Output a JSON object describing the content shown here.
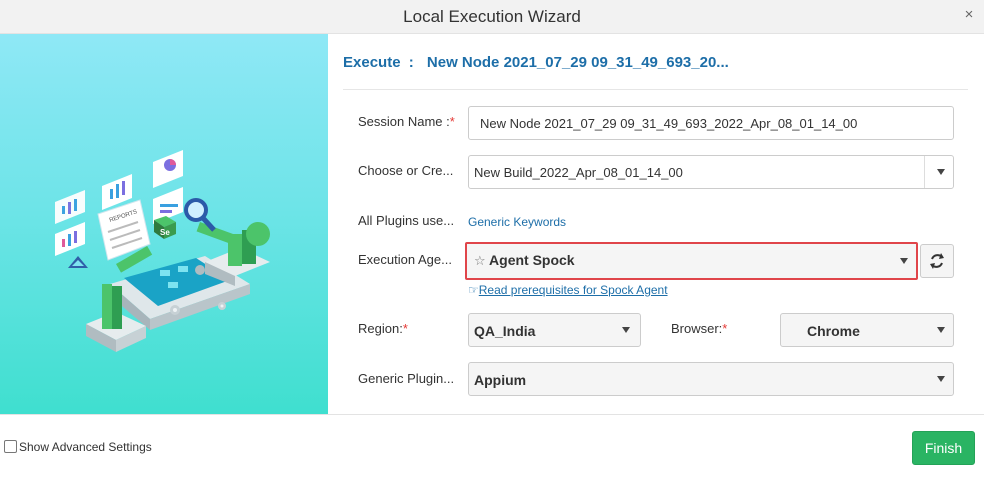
{
  "dialog": {
    "title": "Local Execution Wizard",
    "close_glyph": "×"
  },
  "execute": {
    "label": "Execute",
    "separator": ":",
    "node_name": "New Node 2021_07_29 09_31_49_693_20..."
  },
  "form": {
    "session_name": {
      "label": "Session Name :",
      "required_mark": "*",
      "value": "New Node 2021_07_29 09_31_49_693_2022_Apr_08_01_14_00"
    },
    "build": {
      "label": "Choose or Cre...",
      "value": "New Build_2022_Apr_08_01_14_00"
    },
    "plugins": {
      "label": "All Plugins use...",
      "link": "Generic Keywords"
    },
    "execution_agent": {
      "label": "Execution Age...",
      "star": "☆",
      "value": "Agent Spock",
      "prereq_icon": "☞",
      "prereq_link": "Read prerequisites for Spock Agent"
    },
    "region": {
      "label": "Region:",
      "required_mark": "*",
      "value": "QA_India"
    },
    "browser": {
      "label": "Browser:",
      "required_mark": "*",
      "value": "Chrome"
    },
    "generic_plugin": {
      "label": "Generic Plugin...",
      "value": "Appium"
    }
  },
  "footer": {
    "show_advanced_label": "Show Advanced Settings",
    "finish_label": "Finish"
  },
  "illustration": {
    "reports_text": "REPORTS",
    "se_text": "Se"
  },
  "colors": {
    "accent_blue": "#1d6ea8",
    "required_red": "#e53935",
    "highlight_border": "#e0454a",
    "finish_green": "#2ab463",
    "illus_top": "#8fe8f6",
    "illus_bottom": "#3fdfcf"
  },
  "icons": {
    "close": "close-icon",
    "caret": "chevron-down-icon",
    "refresh": "refresh-icon",
    "star": "star-icon",
    "hand": "pointing-hand-icon",
    "checkbox": "checkbox-icon"
  }
}
